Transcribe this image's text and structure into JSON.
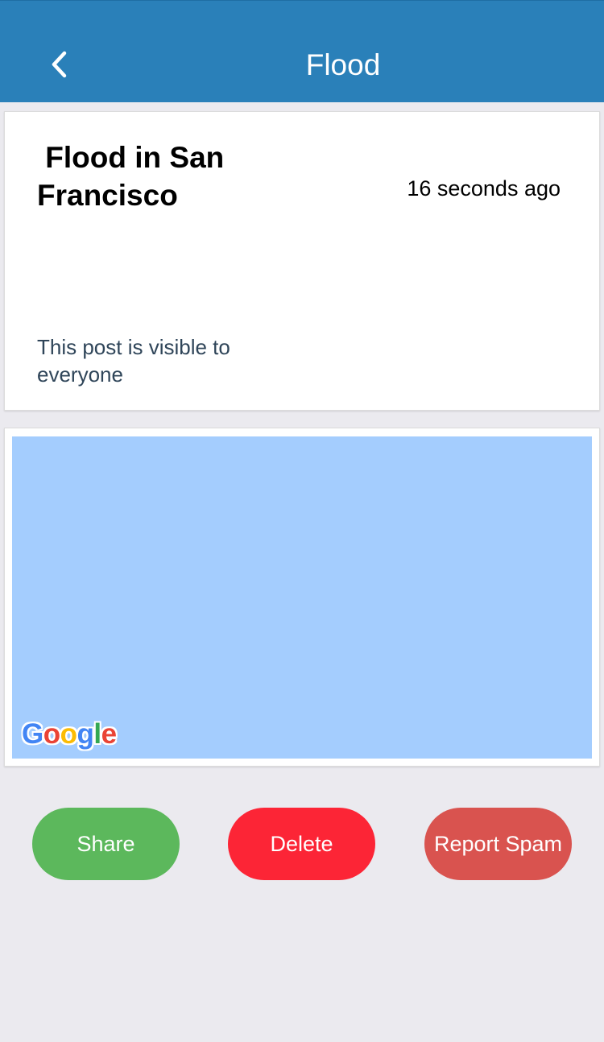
{
  "colors": {
    "navbar": "#2a80b9",
    "background": "#ebeaef",
    "map_water": "#a4cdfe",
    "share": "#5cb85c",
    "delete": "#fc2536",
    "report_spam": "#d9534f"
  },
  "header": {
    "back_icon": "chevron-left-icon",
    "title": "Flood"
  },
  "post": {
    "title": " Flood in San\nFrancisco",
    "time": "16 seconds ago",
    "visibility": "This post is visible to everyone"
  },
  "map": {
    "logo_letters": [
      "G",
      "o",
      "o",
      "g",
      "l",
      "e"
    ],
    "logo_colors": [
      "#4285f4",
      "#ea4335",
      "#fbbc05",
      "#4285f4",
      "#34a853",
      "#ea4335"
    ]
  },
  "actions": {
    "share_label": "Share",
    "delete_label": "Delete",
    "report_spam_label": "Report Spam"
  }
}
